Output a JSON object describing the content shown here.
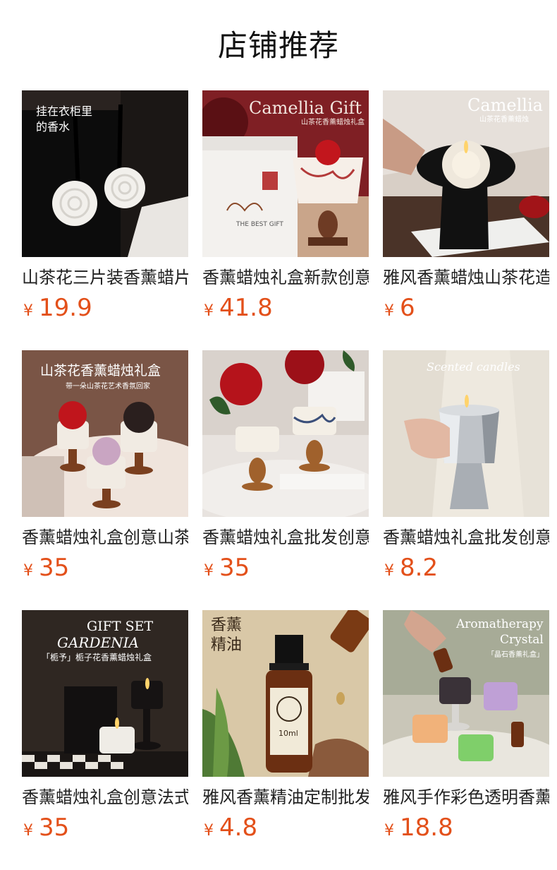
{
  "title": "店铺推荐",
  "currency": "¥",
  "accent_color": "#e3501a",
  "products": [
    {
      "name": "山茶花三片装香薰蜡片",
      "price": "19.9",
      "image_texts": [
        "挂在衣柜里",
        "的香水"
      ],
      "icon": "rose-wax-sachet-image"
    },
    {
      "name": "香薰蜡烛礼盒新款创意",
      "price": "41.8",
      "image_texts": [
        "Camellia Gift",
        "山茶花香薰蜡烛礼盒",
        "THE BEST GIFT"
      ],
      "icon": "camellia-gift-box-image"
    },
    {
      "name": "雅风香薰蜡烛山茶花造型",
      "price": "6",
      "image_texts": [
        "Camellia",
        "山茶花香薰蜡烛"
      ],
      "icon": "camellia-candle-image"
    },
    {
      "name": "香薰蜡烛礼盒创意山茶花",
      "price": "35",
      "image_texts": [
        "山茶花香薰蜡烛礼盒",
        "带一朵山茶花艺术香氛回家"
      ],
      "icon": "three-candles-image"
    },
    {
      "name": "香薰蜡烛礼盒批发创意",
      "price": "35",
      "image_texts": [],
      "icon": "rose-candles-image"
    },
    {
      "name": "香薰蜡烛礼盒批发创意",
      "price": "8.2",
      "image_texts": [
        "Scented candles"
      ],
      "icon": "silver-candle-image"
    },
    {
      "name": "香薰蜡烛礼盒创意法式",
      "price": "35",
      "image_texts": [
        "GIFT SET",
        "GARDENIA",
        "「栀予」栀子花香薰蜡烛礼盒"
      ],
      "icon": "gardenia-gift-set-image"
    },
    {
      "name": "雅风香薰精油定制批发",
      "price": "4.8",
      "image_texts": [
        "香薰",
        "精油",
        "10ml"
      ],
      "icon": "essential-oil-bottle-image"
    },
    {
      "name": "雅风手作彩色透明香薰",
      "price": "18.8",
      "image_texts": [
        "Aromatherapy",
        "Crystal",
        "「晶石香薰礼盒」"
      ],
      "icon": "crystal-candles-image"
    }
  ]
}
